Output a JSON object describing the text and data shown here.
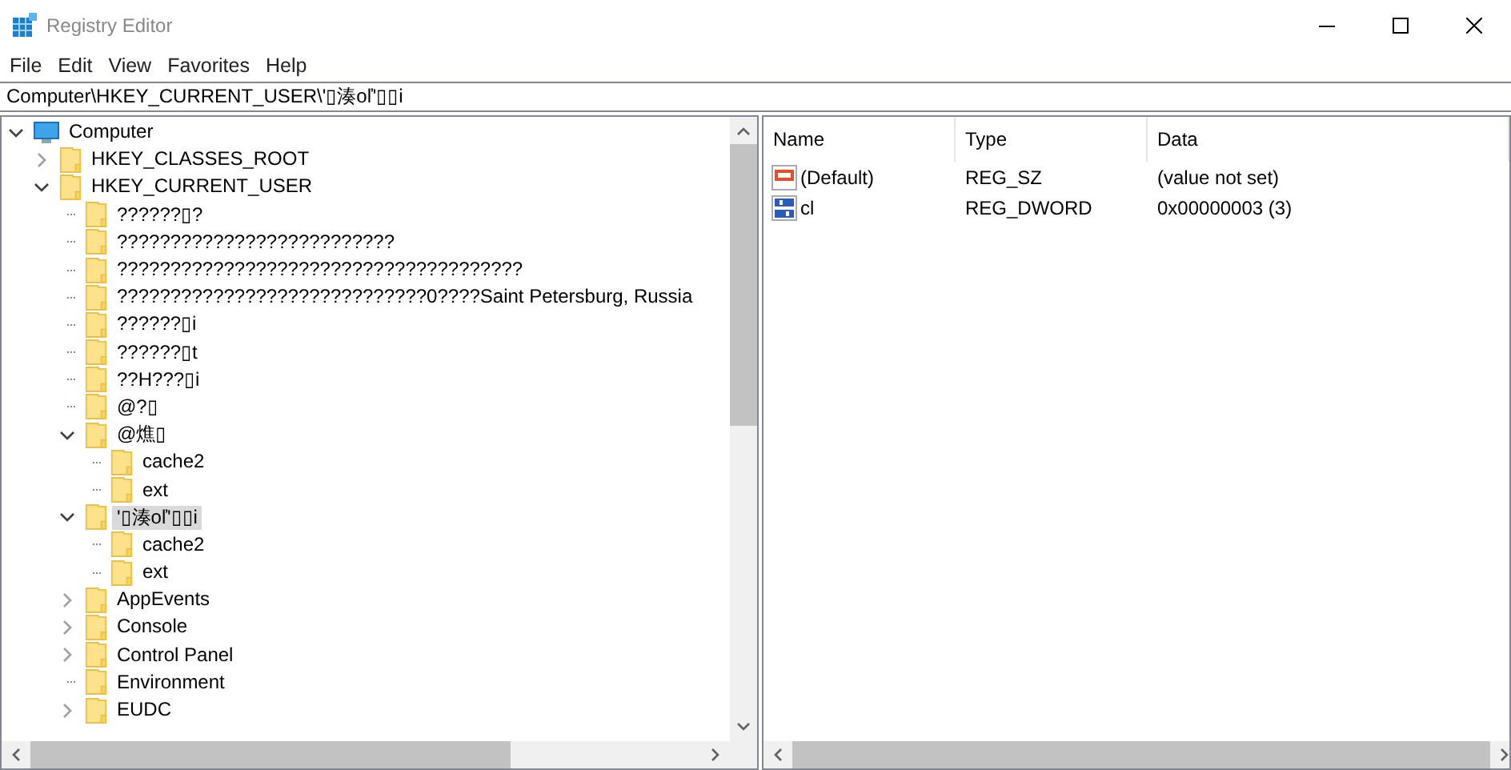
{
  "window": {
    "title": "Registry Editor"
  },
  "menu": [
    "File",
    "Edit",
    "View",
    "Favorites",
    "Help"
  ],
  "address": "Computer\\HKEY_CURRENT_USER\\'▯湊oľ'▯▯i",
  "tree": [
    {
      "label": "Computer",
      "expanded": true,
      "selected": false,
      "children": [
        {
          "label": "HKEY_CLASSES_ROOT",
          "expanded": false,
          "selected": false
        },
        {
          "label": "HKEY_CURRENT_USER",
          "expanded": true,
          "selected": false,
          "children": [
            {
              "label": "??????▯?",
              "selected": false
            },
            {
              "label": "??????????????????????????",
              "selected": false
            },
            {
              "label": "??????????????????????????????????????",
              "selected": false
            },
            {
              "label": "?????????????????????????????0????Saint Petersburg, Russia",
              "selected": false
            },
            {
              "label": "??????▯i",
              "selected": false
            },
            {
              "label": "??????▯t",
              "selected": false
            },
            {
              "label": "??H???▯i",
              "selected": false
            },
            {
              "label": "@?▯",
              "selected": false
            },
            {
              "label": "@燋▯",
              "expanded": true,
              "selected": false,
              "children": [
                {
                  "label": "cache2",
                  "selected": false
                },
                {
                  "label": "ext",
                  "selected": false
                }
              ]
            },
            {
              "label": "'▯湊oľ'▯▯i",
              "expanded": true,
              "selected": true,
              "children": [
                {
                  "label": "cache2",
                  "selected": false
                },
                {
                  "label": "ext",
                  "selected": false
                }
              ]
            },
            {
              "label": "AppEvents",
              "expanded": false,
              "selected": false
            },
            {
              "label": "Console",
              "expanded": false,
              "selected": false
            },
            {
              "label": "Control Panel",
              "expanded": false,
              "selected": false
            },
            {
              "label": "Environment",
              "selected": false
            },
            {
              "label": "EUDC",
              "expanded": false,
              "selected": false
            }
          ]
        }
      ]
    }
  ],
  "values": {
    "columns": [
      "Name",
      "Type",
      "Data"
    ],
    "rows": [
      {
        "kind": "string",
        "name": "(Default)",
        "type": "REG_SZ",
        "data": "(value not set)"
      },
      {
        "kind": "binary",
        "name": "cl",
        "type": "REG_DWORD",
        "data": "0x00000003 (3)"
      }
    ]
  }
}
